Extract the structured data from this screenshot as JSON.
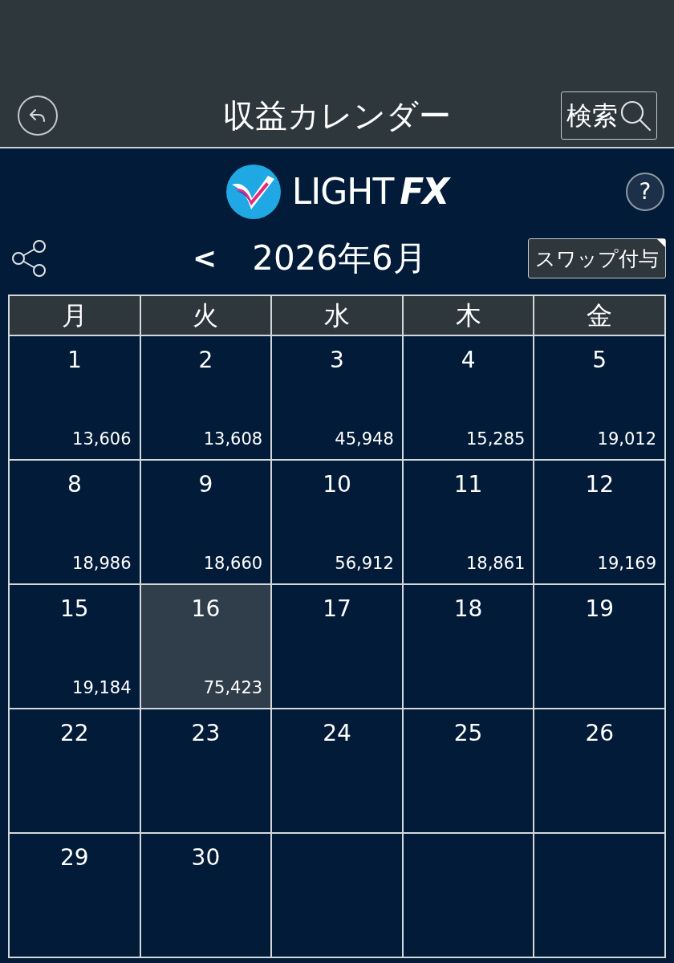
{
  "header": {
    "title": "収益カレンダー",
    "search_button": "検索"
  },
  "logo": {
    "word": "LIGHT",
    "accent": "FX"
  },
  "help_button": "?",
  "month_nav": {
    "prev_button": "<",
    "month": "2026年6月",
    "swap_button": "スワップ付与"
  },
  "calendar": {
    "weekdays": [
      "月",
      "火",
      "水",
      "木",
      "金"
    ],
    "weeks": [
      [
        {
          "day": "1",
          "amount": "13,606",
          "selected": false
        },
        {
          "day": "2",
          "amount": "13,608",
          "selected": false
        },
        {
          "day": "3",
          "amount": "45,948",
          "selected": false
        },
        {
          "day": "4",
          "amount": "15,285",
          "selected": false
        },
        {
          "day": "5",
          "amount": "19,012",
          "selected": false
        }
      ],
      [
        {
          "day": "8",
          "amount": "18,986",
          "selected": false
        },
        {
          "day": "9",
          "amount": "18,660",
          "selected": false
        },
        {
          "day": "10",
          "amount": "56,912",
          "selected": false
        },
        {
          "day": "11",
          "amount": "18,861",
          "selected": false
        },
        {
          "day": "12",
          "amount": "19,169",
          "selected": false
        }
      ],
      [
        {
          "day": "15",
          "amount": "19,184",
          "selected": false
        },
        {
          "day": "16",
          "amount": "75,423",
          "selected": true
        },
        {
          "day": "17",
          "selected": false
        },
        {
          "day": "18",
          "selected": false
        },
        {
          "day": "19",
          "selected": false
        }
      ],
      [
        {
          "day": "22",
          "selected": false
        },
        {
          "day": "23",
          "selected": false
        },
        {
          "day": "24",
          "selected": false
        },
        {
          "day": "25",
          "selected": false
        },
        {
          "day": "26",
          "selected": false
        }
      ],
      [
        {
          "day": "29",
          "selected": false
        },
        {
          "day": "30",
          "selected": false
        }
      ]
    ]
  }
}
